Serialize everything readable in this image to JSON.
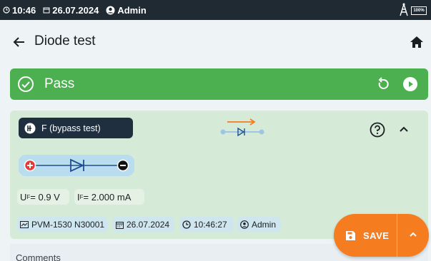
{
  "status": {
    "time": "10:46",
    "date": "26.07.2024",
    "user": "Admin",
    "battery": "100%",
    "icons": [
      "clock-icon",
      "calendar-icon",
      "user-icon",
      "network-tower-icon",
      "battery-icon"
    ]
  },
  "header": {
    "title": "Diode test"
  },
  "result": {
    "label": "Pass",
    "color": "#4caf50"
  },
  "test": {
    "mode_label": "F (bypass test)",
    "measurements": {
      "uf": {
        "symbol": "U",
        "sub": "F",
        "value": " = 0.9 V"
      },
      "if": {
        "symbol": "I",
        "sub": "F",
        "value": " = 2.000 mA"
      }
    },
    "info": {
      "device": "PVM-1530 N30001",
      "date": "26.07.2024",
      "time": "10:46:27",
      "user": "Admin"
    }
  },
  "comments": {
    "label": "Comments"
  },
  "fab": {
    "save_label": "SAVE",
    "color": "#f57c1f"
  }
}
